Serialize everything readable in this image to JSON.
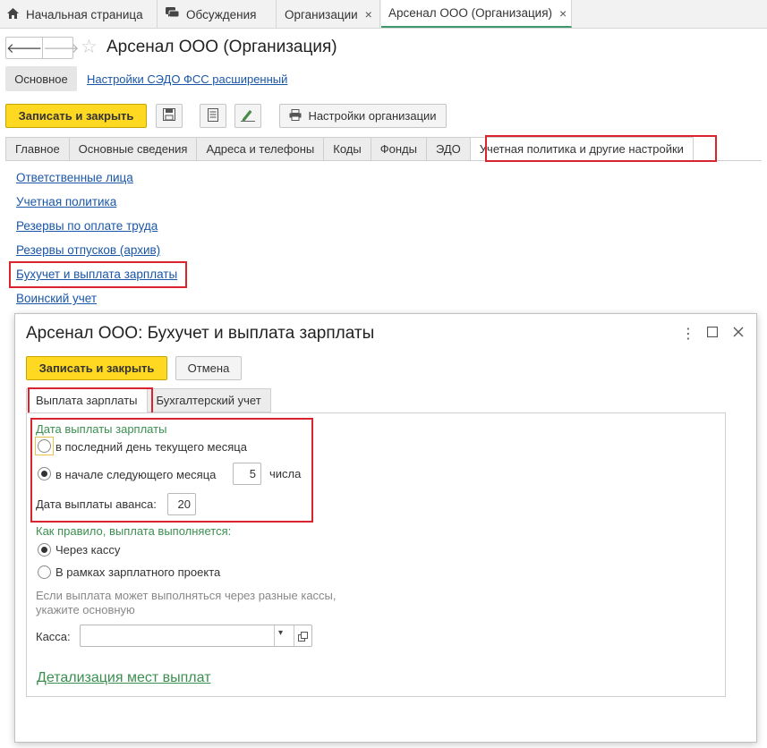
{
  "top_tabs": [
    {
      "label": "Начальная страница"
    },
    {
      "label": "Обсуждения"
    },
    {
      "label": "Организации"
    },
    {
      "label": "Арсенал ООО (Организация)"
    }
  ],
  "header": {
    "title": "Арсенал ООО (Организация)",
    "section_main": "Основное",
    "section_link": "Настройки СЭДО ФСС расширенный"
  },
  "toolbar": {
    "save_close": "Записать и закрыть",
    "org_settings": "Настройки организации"
  },
  "form_tabs": [
    {
      "label": "Главное"
    },
    {
      "label": "Основные сведения"
    },
    {
      "label": "Адреса и телефоны"
    },
    {
      "label": "Коды"
    },
    {
      "label": "Фонды"
    },
    {
      "label": "ЭДО"
    },
    {
      "label": "Учетная политика и другие настройки"
    }
  ],
  "links": [
    {
      "label": "Ответственные лица"
    },
    {
      "label": "Учетная политика"
    },
    {
      "label": "Резервы по оплате труда"
    },
    {
      "label": "Резервы отпусков (архив)"
    },
    {
      "label": "Бухучет и выплата зарплаты"
    },
    {
      "label": "Воинский учет"
    }
  ],
  "modal": {
    "title": "Арсенал ООО: Бухучет и выплата зарплаты",
    "save_close": "Записать и закрыть",
    "cancel": "Отмена",
    "tabs": [
      {
        "label": "Выплата зарплаты"
      },
      {
        "label": "Бухгалтерский учет"
      }
    ],
    "pay_date_group": "Дата выплаты зарплаты",
    "opt_last_day": "в последний день текущего месяца",
    "opt_next_month": "в начале следующего месяца",
    "day_value": "5",
    "day_suffix": "числа",
    "advance_label": "Дата выплаты аванса:",
    "advance_value": "20",
    "method_group": "Как правило, выплата выполняется:",
    "opt_cash": "Через кассу",
    "opt_project": "В рамках зарплатного проекта",
    "note_line1": "Если выплата может выполняться через разные кассы,",
    "note_line2": "укажите основную",
    "kassa_label": "Касса:",
    "kassa_value": "",
    "detail_link": "Детализация мест выплат"
  },
  "colors": {
    "accent_green": "#3a8f4f",
    "highlight_red": "#d9232e",
    "button_yellow": "#ffd822",
    "link_blue": "#1a56a8"
  }
}
